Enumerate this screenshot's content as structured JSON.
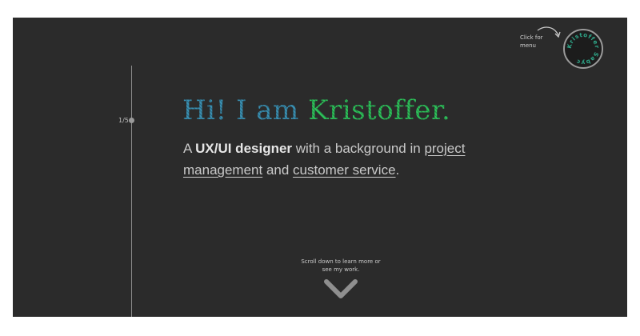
{
  "nav": {
    "page_counter": "1/5"
  },
  "hero": {
    "title_greeting": "Hi! I am ",
    "title_name": "Kristoffer.",
    "subtitle_prefix": "A ",
    "subtitle_role": "UX/UI designer",
    "subtitle_mid": " with a background in ",
    "link_project_management": "project management",
    "subtitle_and": " and ",
    "link_customer_service": "customer service",
    "subtitle_end": "."
  },
  "menu": {
    "hint": "Click for menu",
    "badge_text": "Kristoffer Sabyc"
  },
  "scroll": {
    "hint": "Scroll down to learn more or see my work."
  },
  "colors": {
    "background": "#2b2b2b",
    "title_blue": "#3a8fb0",
    "title_green": "#2fbf5a",
    "text": "#c9c9c9"
  }
}
